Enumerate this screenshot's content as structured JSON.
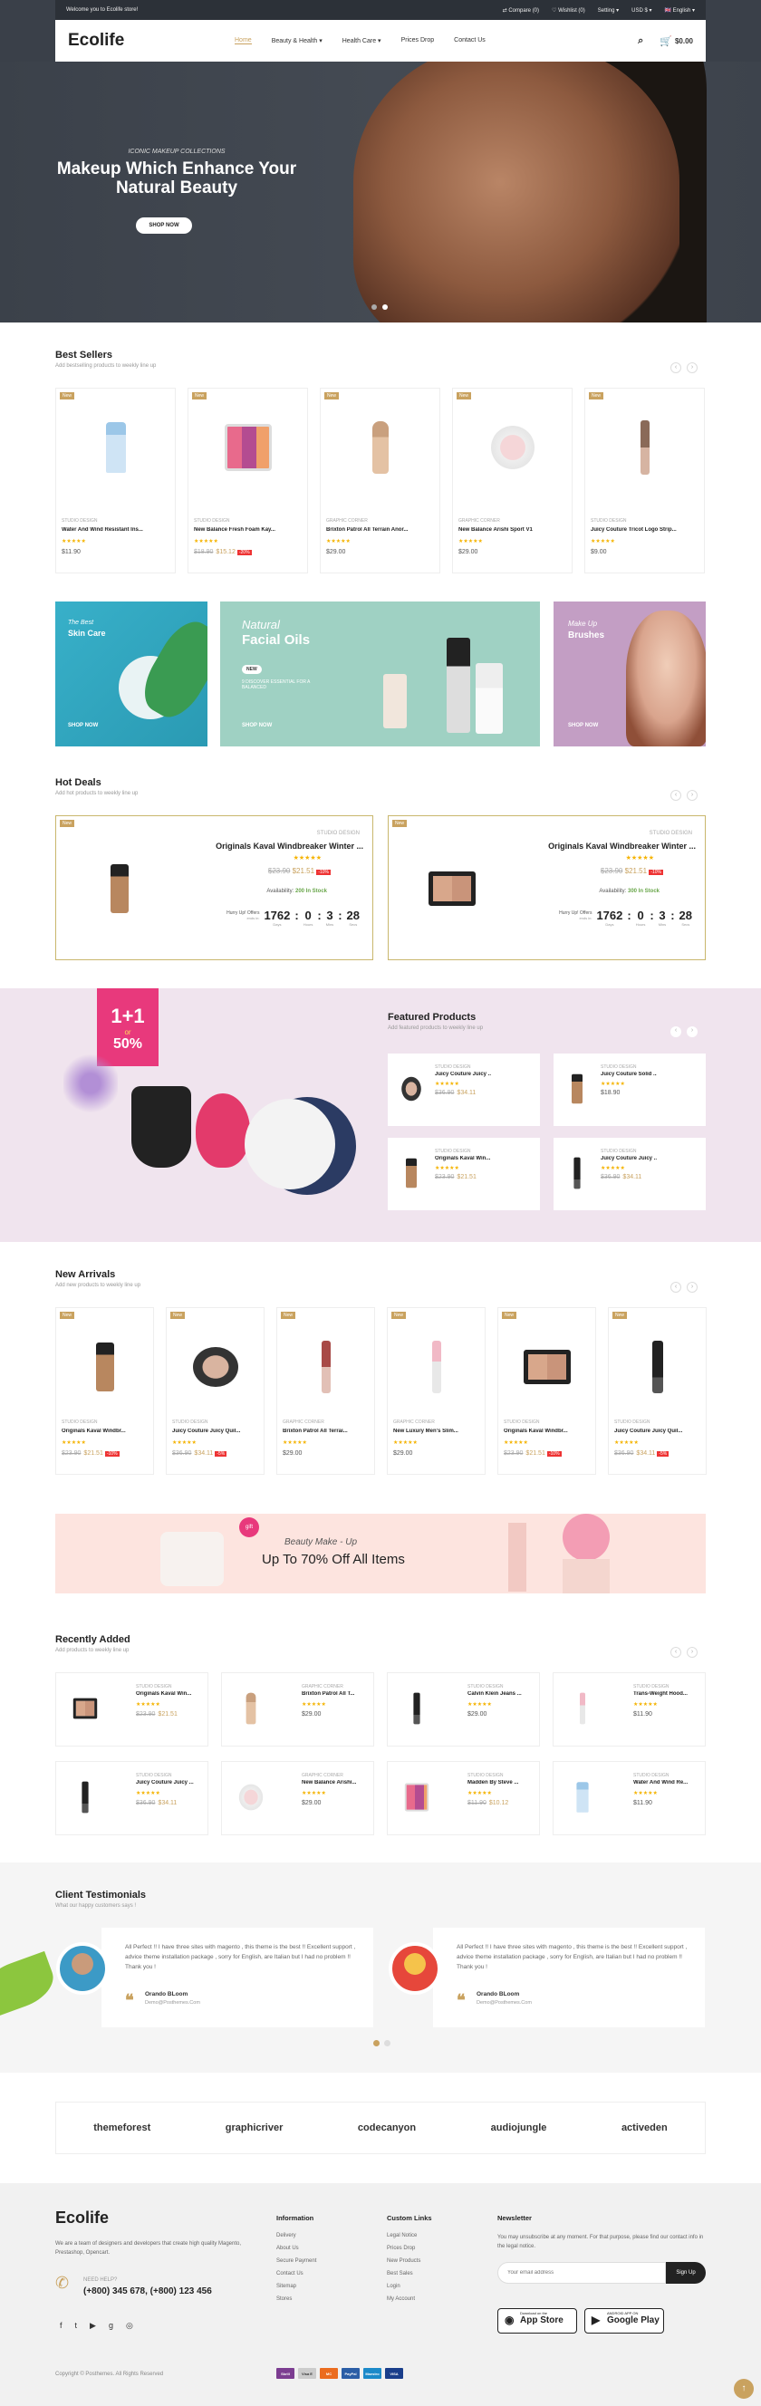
{
  "topbar": {
    "welcome": "Welcome you to Ecolife store!",
    "compare": "Compare (0)",
    "wishlist": "Wishlist (0)",
    "setting": "Setting",
    "currency": "USD $",
    "language": "English"
  },
  "header": {
    "logo": "Ecolife",
    "nav": [
      "Home",
      "Beauty & Health",
      "Health Care",
      "Prices Drop",
      "Contact Us"
    ],
    "cart_total": "$0.00",
    "cart_count": "0"
  },
  "hero": {
    "tag": "ICONIC MAKEUP COLLECTIONS",
    "title": "Makeup Which Enhance Your Natural Beauty",
    "button": "SHOP NOW"
  },
  "best_sellers": {
    "title": "Best Sellers",
    "subtitle": "Add bestselling products to weekly line up",
    "products": [
      {
        "badge": "New",
        "cat": "STUDIO DESIGN",
        "name": "Water And Wind Resistant Ins...",
        "stars": "★★★★★",
        "old": "",
        "price": "$11.90",
        "off": ""
      },
      {
        "badge": "New",
        "cat": "STUDIO DESIGN",
        "name": "New Balance Fresh Foam Kay...",
        "stars": "★★★★★",
        "old": "$18.90",
        "price": "$15.12",
        "off": "-20%"
      },
      {
        "badge": "New",
        "cat": "GRAPHIC CORNER",
        "name": "Brixton Patrol All Terrain Anor...",
        "stars": "★★★★★",
        "old": "",
        "price": "$29.00",
        "off": ""
      },
      {
        "badge": "New",
        "cat": "GRAPHIC CORNER",
        "name": "New Balance Arishi Sport V1",
        "stars": "★★★★★",
        "old": "",
        "price": "$29.00",
        "off": ""
      },
      {
        "badge": "New",
        "cat": "STUDIO DESIGN",
        "name": "Juicy Couture Tricot Logo Strip...",
        "stars": "★★★★★",
        "old": "",
        "price": "$9.00",
        "off": ""
      }
    ]
  },
  "banners": [
    {
      "t1": "The Best",
      "t2": "Skin Care",
      "shop": "SHOP NOW"
    },
    {
      "t1": "Natural",
      "t2": "Facial Oils",
      "badge": "NEW",
      "desc": "9 DISCOVER ESSENTIAL FOR A BALANCED",
      "shop": "SHOP NOW"
    },
    {
      "t1": "Make Up",
      "t2": "Brushes",
      "shop": "SHOP NOW"
    }
  ],
  "hot_deals": {
    "title": "Hot Deals",
    "subtitle": "Add hot products to weekly line up",
    "items": [
      {
        "badge": "New",
        "cat": "STUDIO DESIGN",
        "name": "Originals Kaval Windbreaker Winter ...",
        "stars": "★★★★★",
        "old": "$23.90",
        "price": "$21.51",
        "off": "-10%",
        "avail_label": "Availability:",
        "avail": "200 In Stock",
        "hurry": "Hurry Up! Offers",
        "ends": "ends in:",
        "days": "1762",
        "hours": "0",
        "mins": "3",
        "secs": "28",
        "l_days": "Days",
        "l_hours": "Hours",
        "l_mins": "Mins",
        "l_secs": "Secs"
      },
      {
        "badge": "New",
        "cat": "STUDIO DESIGN",
        "name": "Originals Kaval Windbreaker Winter ...",
        "stars": "★★★★★",
        "old": "$23.90",
        "price": "$21.51",
        "off": "-10%",
        "avail_label": "Availability:",
        "avail": "300 In Stock",
        "hurry": "Hurry Up! Offers",
        "ends": "ends in:",
        "days": "1762",
        "hours": "0",
        "mins": "3",
        "secs": "28",
        "l_days": "Days",
        "l_hours": "Hours",
        "l_mins": "Mins",
        "l_secs": "Secs"
      }
    ]
  },
  "promo_box": {
    "big": "1+1",
    "or": "or",
    "pct": "50%"
  },
  "featured": {
    "title": "Featured Products",
    "subtitle": "Add featured products to weekly line up",
    "items": [
      {
        "cat": "STUDIO DESIGN",
        "name": "Juicy Couture Juicy ...",
        "stars": "★★★★★",
        "old": "$36.90",
        "price": "$34.11"
      },
      {
        "cat": "STUDIO DESIGN",
        "name": "Juicy Couture Solid ...",
        "stars": "★★★★★",
        "old": "",
        "price": "$18.90"
      },
      {
        "cat": "STUDIO DESIGN",
        "name": "Originals Kaval Win...",
        "stars": "★★★★★",
        "old": "$23.90",
        "price": "$21.51"
      },
      {
        "cat": "STUDIO DESIGN",
        "name": "Juicy Couture Juicy ...",
        "stars": "★★★★★",
        "old": "$36.90",
        "price": "$34.11"
      }
    ]
  },
  "new_arrivals": {
    "title": "New Arrivals",
    "subtitle": "Add new products to weekly line up",
    "products": [
      {
        "badge": "New",
        "cat": "STUDIO DESIGN",
        "name": "Originals Kaval Windbr...",
        "stars": "★★★★★",
        "old": "$23.90",
        "price": "$21.51",
        "off": "-10%"
      },
      {
        "badge": "New",
        "cat": "STUDIO DESIGN",
        "name": "Juicy Couture Juicy Quil...",
        "stars": "★★★★★",
        "old": "$36.90",
        "price": "$34.11",
        "off": "-5%"
      },
      {
        "badge": "New",
        "cat": "GRAPHIC CORNER",
        "name": "Brixton Patrol All Terrai...",
        "stars": "★★★★★",
        "old": "",
        "price": "$29.00",
        "off": ""
      },
      {
        "badge": "New",
        "cat": "GRAPHIC CORNER",
        "name": "New Luxury Men's Slim...",
        "stars": "★★★★★",
        "old": "",
        "price": "$29.00",
        "off": ""
      },
      {
        "badge": "New",
        "cat": "STUDIO DESIGN",
        "name": "Originals Kaval Windbr...",
        "stars": "★★★★★",
        "old": "$23.90",
        "price": "$21.51",
        "off": "-10%"
      },
      {
        "badge": "New",
        "cat": "STUDIO DESIGN",
        "name": "Juicy Couture Juicy Quil...",
        "stars": "★★★★★",
        "old": "$36.90",
        "price": "$34.11",
        "off": "-5%"
      }
    ]
  },
  "promo": {
    "gift": "gift",
    "t1": "Beauty Make - Up",
    "t2": "Up To 70% Off All Items"
  },
  "recently": {
    "title": "Recently Added",
    "subtitle": "Add products to weekly line up",
    "items": [
      {
        "cat": "STUDIO DESIGN",
        "name": "Originals Kaval Win...",
        "stars": "★★★★★",
        "old": "$23.90",
        "price": "$21.51"
      },
      {
        "cat": "GRAPHIC CORNER",
        "name": "Brixton Patrol All T...",
        "stars": "★★★★★",
        "old": "",
        "price": "$29.00"
      },
      {
        "cat": "STUDIO DESIGN",
        "name": "Calvin Klein Jeans ...",
        "stars": "★★★★★",
        "old": "",
        "price": "$29.00"
      },
      {
        "cat": "STUDIO DESIGN",
        "name": "Trans-Weight Hood...",
        "stars": "★★★★★",
        "old": "",
        "price": "$11.90"
      },
      {
        "cat": "STUDIO DESIGN",
        "name": "Juicy Couture Juicy ...",
        "stars": "★★★★★",
        "old": "$36.90",
        "price": "$34.11"
      },
      {
        "cat": "GRAPHIC CORNER",
        "name": "New Balance Arishi...",
        "stars": "★★★★★",
        "old": "",
        "price": "$29.00"
      },
      {
        "cat": "STUDIO DESIGN",
        "name": "Madden By Steve ...",
        "stars": "★★★★★",
        "old": "$11.90",
        "price": "$10.12"
      },
      {
        "cat": "STUDIO DESIGN",
        "name": "Water And Wind Re...",
        "stars": "★★★★★",
        "old": "",
        "price": "$11.90"
      }
    ]
  },
  "testimonials": {
    "title": "Client Testimonials",
    "subtitle": "What our happy customers says !",
    "items": [
      {
        "text": "All Perfect !! I have three sites with magento , this theme is the best !! Excellent support , advice theme installation package , sorry for English, are Italian but I had no problem !! Thank you !",
        "name": "Orando BLoom",
        "email": "Demo@Posthemes.Com"
      },
      {
        "text": "All Perfect !! I have three sites with magento , this theme is the best !! Excellent support , advice theme installation package , sorry for English, are Italian but I had no problem !! Thank you !",
        "name": "Orando BLoom",
        "email": "Demo@Posthemes.Com"
      }
    ]
  },
  "brands": [
    "themeforest",
    "graphicriver",
    "codecanyon",
    "audiojungle",
    "activeden"
  ],
  "footer": {
    "logo": "Ecolife",
    "about": "We are a team of designers and developers that create high quality Magento, Prestashop, Opencart.",
    "help_label": "NEED HELP?",
    "phone": "(+800) 345 678, (+800) 123 456",
    "info_title": "Information",
    "info": [
      "Delivery",
      "About Us",
      "Secure Payment",
      "Contact Us",
      "Sitemap",
      "Stores"
    ],
    "links_title": "Custom Links",
    "links": [
      "Legal Notice",
      "Prices Drop",
      "New Products",
      "Best Sales",
      "Login",
      "My Account"
    ],
    "news_title": "Newsletter",
    "news_text": "You may unsubscribe at any moment. For that purpose, please find our contact info in the legal notice.",
    "email_placeholder": "Your email address",
    "signup": "Sign Up",
    "appstore_small": "Download on the",
    "appstore": "App Store",
    "google_small": "ANDROID APP ON",
    "google": "Google Play",
    "copyright": "Copyright © Posthemes. All Rights Reserved",
    "payments": [
      "Skrill",
      "Visa E",
      "MC",
      "PayPal",
      "Maestro",
      "VISA"
    ]
  },
  "colors": {
    "accent": "#c9a25f",
    "dark": "#3a4049",
    "sale": "#e33333",
    "featured_bg": "#f0e4ee",
    "promo_bg": "#fde4df"
  }
}
